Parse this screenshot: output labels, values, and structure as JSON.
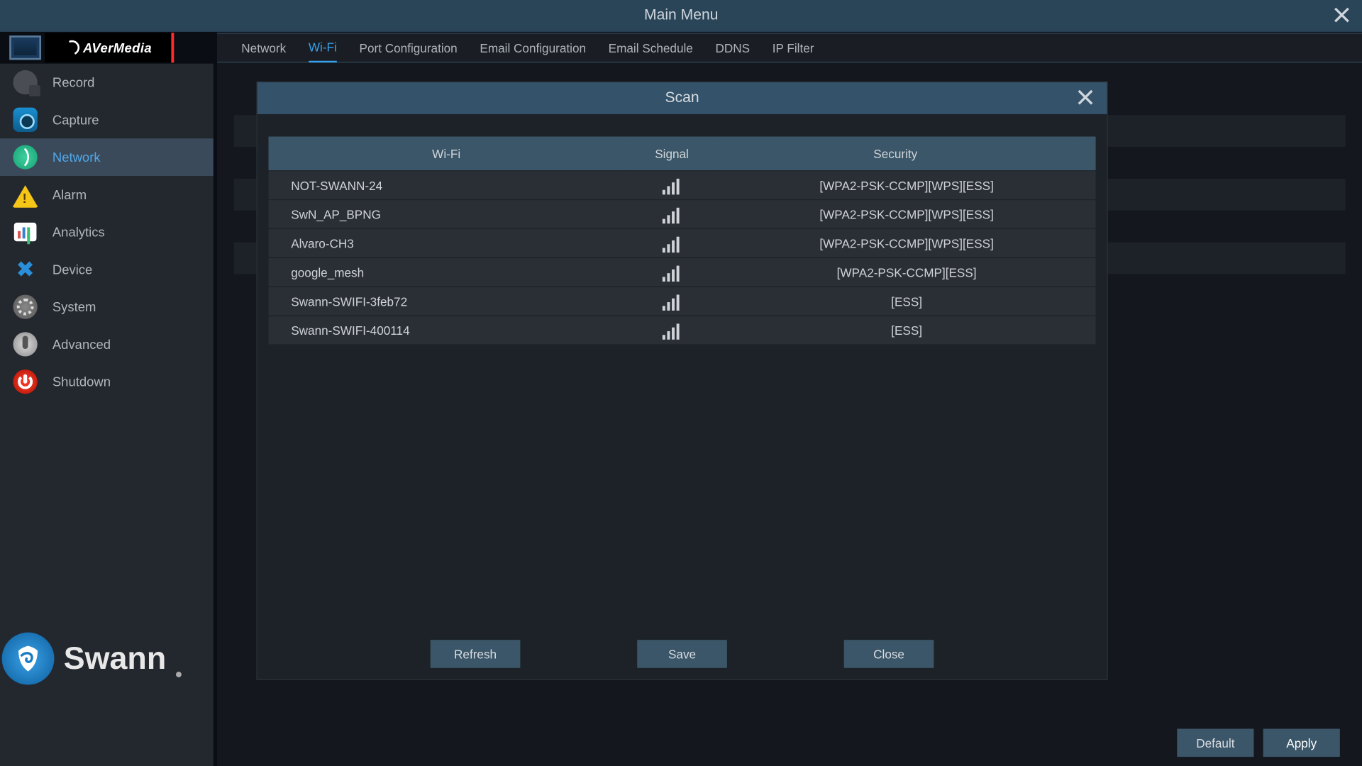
{
  "window": {
    "title": "Main Menu"
  },
  "brand": {
    "name": "AVerMedia"
  },
  "sidebar": {
    "items": [
      {
        "label": "Record"
      },
      {
        "label": "Capture"
      },
      {
        "label": "Network"
      },
      {
        "label": "Alarm"
      },
      {
        "label": "Analytics"
      },
      {
        "label": "Device"
      },
      {
        "label": "System"
      },
      {
        "label": "Advanced"
      },
      {
        "label": "Shutdown"
      }
    ]
  },
  "bottom_brand": "Swann",
  "tabs": [
    {
      "label": "Network"
    },
    {
      "label": "Wi-Fi"
    },
    {
      "label": "Port Configuration"
    },
    {
      "label": "Email Configuration"
    },
    {
      "label": "Email Schedule"
    },
    {
      "label": "DDNS"
    },
    {
      "label": "IP Filter"
    }
  ],
  "footer": {
    "default": "Default",
    "apply": "Apply"
  },
  "modal": {
    "title": "Scan",
    "columns": {
      "wifi": "Wi-Fi",
      "signal": "Signal",
      "security": "Security"
    },
    "rows": [
      {
        "ssid": "NOT-SWANN-24",
        "security": "[WPA2-PSK-CCMP][WPS][ESS]"
      },
      {
        "ssid": "SwN_AP_BPNG",
        "security": "[WPA2-PSK-CCMP][WPS][ESS]"
      },
      {
        "ssid": "Alvaro-CH3",
        "security": "[WPA2-PSK-CCMP][WPS][ESS]"
      },
      {
        "ssid": "google_mesh",
        "security": "[WPA2-PSK-CCMP][ESS]"
      },
      {
        "ssid": "Swann-SWIFI-3feb72",
        "security": "[ESS]"
      },
      {
        "ssid": "Swann-SWIFI-400114",
        "security": "[ESS]"
      }
    ],
    "buttons": {
      "refresh": "Refresh",
      "save": "Save",
      "close": "Close"
    }
  }
}
